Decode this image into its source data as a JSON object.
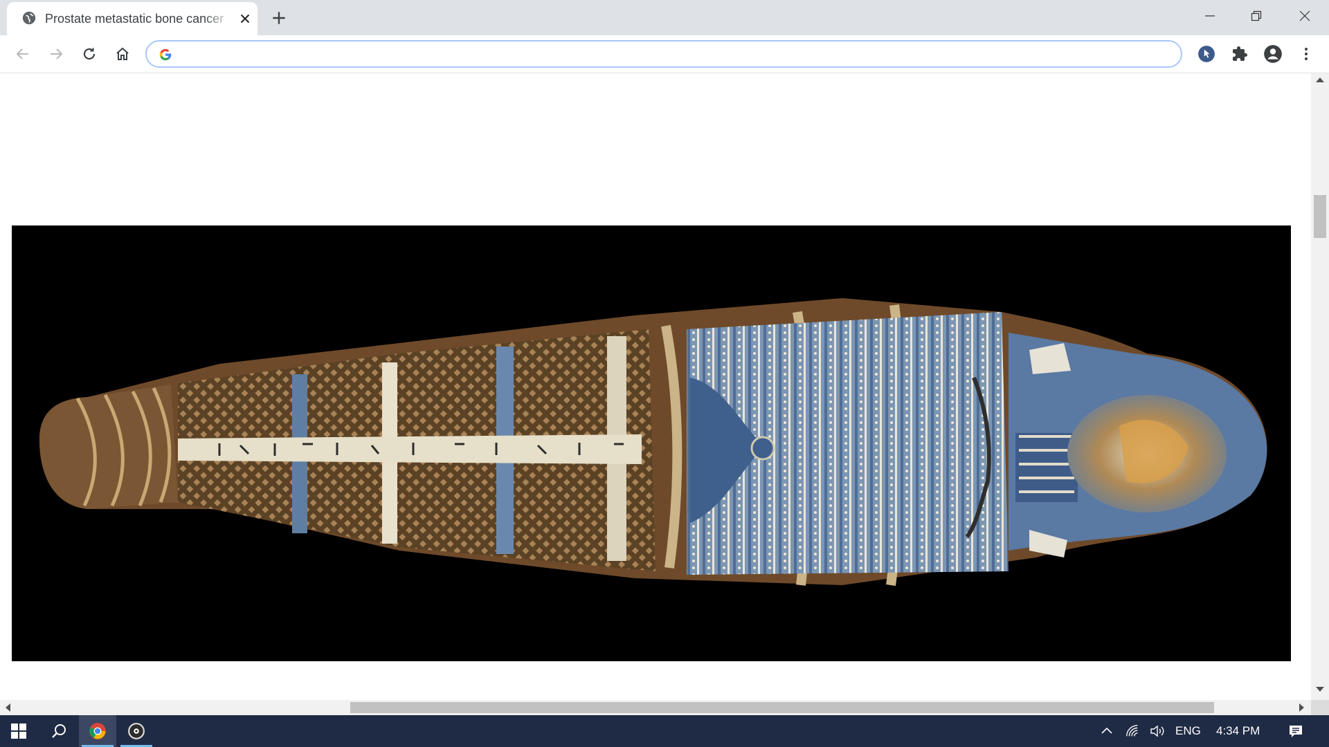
{
  "browser": {
    "tab": {
      "title": "Prostate metastatic bone cancer",
      "favicon": "globe-icon"
    },
    "toolbar": {
      "back_icon": "arrow-left-icon",
      "forward_icon": "arrow-right-icon",
      "reload_icon": "reload-icon",
      "home_icon": "home-icon",
      "address_value": "",
      "extensions": [
        "cursor-extension-icon",
        "puzzle-icon",
        "profile-icon",
        "more-vert-icon"
      ]
    },
    "colors": {
      "tabstrip": "#dee1e6",
      "omnibox_border": "#a8c7fa"
    }
  },
  "content": {
    "image": {
      "subject": "egyptian-mummy-cartonnage",
      "background": "#000000"
    }
  },
  "taskbar": {
    "items": [
      "windows-start-icon",
      "search-icon",
      "chrome-icon",
      "app-icon"
    ],
    "tray": {
      "language": "ENG",
      "time": "4:34 PM"
    },
    "colors": {
      "background": "#1f2a44",
      "accent": "#76b9ed"
    }
  }
}
